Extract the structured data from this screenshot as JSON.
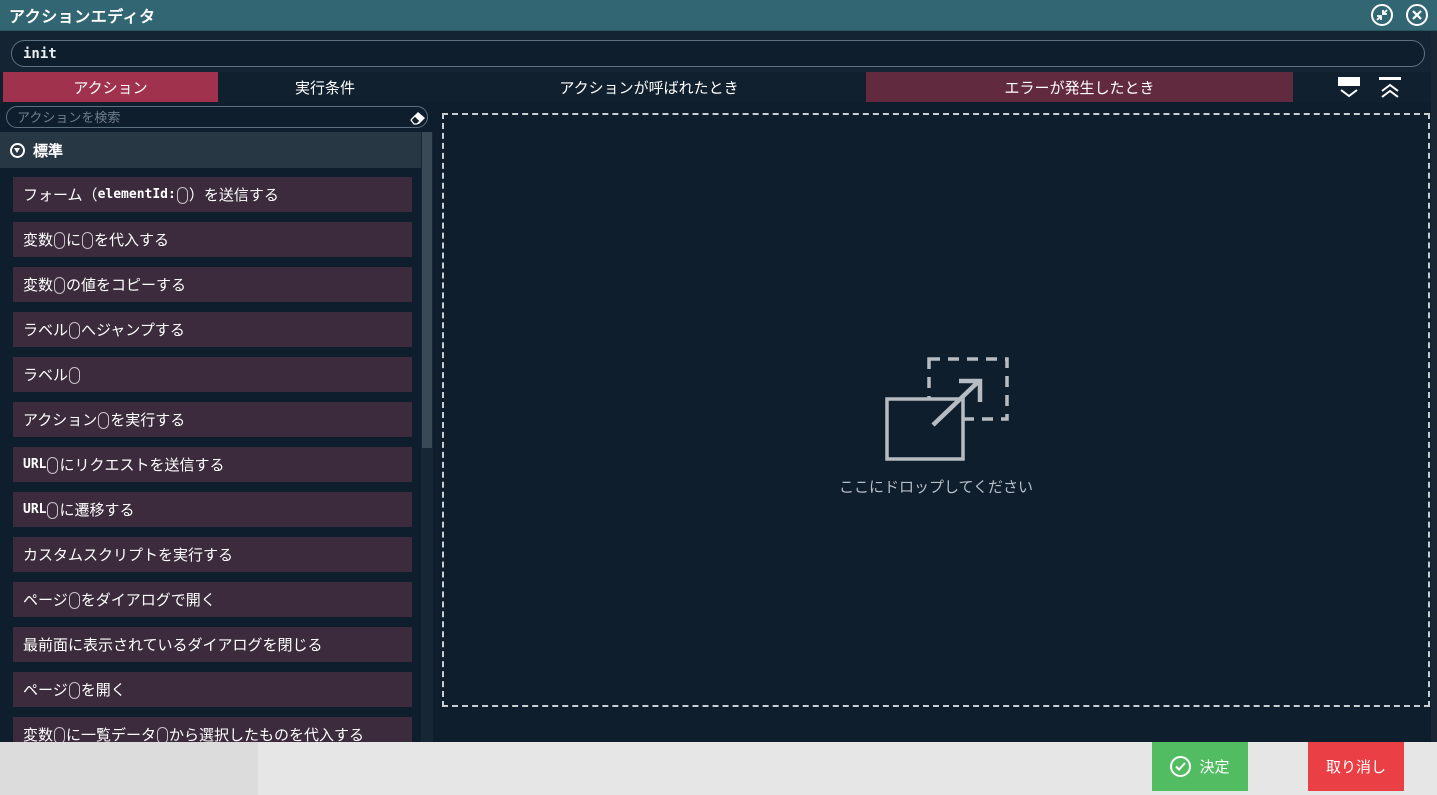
{
  "window": {
    "title": "アクションエディタ",
    "shrink_icon": "shrink-icon",
    "close_icon": "close-icon"
  },
  "name_field": {
    "value": "init"
  },
  "tabs": [
    {
      "label": "アクション",
      "active": true
    },
    {
      "label": "実行条件"
    },
    {
      "label": "アクションが呼ばれたとき"
    },
    {
      "label": "エラーが発生したとき"
    }
  ],
  "toolbar_icons": [
    "expand-all-icon",
    "collapse-all-icon"
  ],
  "search": {
    "placeholder": "アクションを検索",
    "clear_icon": "eraser-icon"
  },
  "section": {
    "label": "標準",
    "icon": "chevron-down-circle-icon"
  },
  "actions": [
    {
      "parts": [
        "フォーム（",
        "elementId:",
        "",
        "）を送信する"
      ]
    },
    {
      "parts": [
        "変数",
        "",
        "に",
        "",
        "を代入する"
      ]
    },
    {
      "parts": [
        "変数",
        "",
        "の値をコピーする"
      ]
    },
    {
      "parts": [
        "ラベル",
        "",
        "へジャンプする"
      ]
    },
    {
      "parts": [
        "ラベル",
        ""
      ]
    },
    {
      "parts": [
        "アクション",
        "",
        "を実行する"
      ]
    },
    {
      "parts": [
        "URL",
        "",
        "にリクエストを送信する"
      ]
    },
    {
      "parts": [
        "URL",
        "",
        "に遷移する"
      ]
    },
    {
      "parts": [
        "カスタムスクリプトを実行する"
      ]
    },
    {
      "parts": [
        "ページ",
        "",
        "をダイアログで開く"
      ]
    },
    {
      "parts": [
        "最前面に表示されているダイアログを閉じる"
      ]
    },
    {
      "parts": [
        "ページ",
        "",
        "を開く"
      ]
    },
    {
      "parts": [
        "変数",
        "",
        "に一覧データ",
        "",
        "から選択したものを代入する"
      ]
    }
  ],
  "dropzone": {
    "text": "ここにドロップしてください",
    "icon": "drop-target-icon"
  },
  "footer": {
    "ok_label": "決定",
    "ok_icon": "check-circle-icon",
    "cancel_label": "取り消し",
    "colors": {
      "ok": "#52bc62",
      "cancel": "#ea4045",
      "accent": "#a1324d",
      "titlebar": "#336673"
    }
  }
}
